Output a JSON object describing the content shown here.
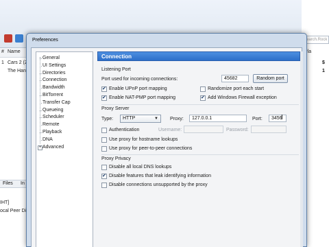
{
  "background_app": {
    "columns": [
      "#",
      "Name"
    ],
    "rows": [
      {
        "num": "1",
        "name": "Cars 2 (2("
      },
      {
        "num": "",
        "name": "The Hang"
      }
    ],
    "tabs": [
      "Files",
      "In"
    ],
    "bottom_lines": [
      "IHT]",
      "ocal Peer Di"
    ],
    "right_panel": {
      "search_text": "earch.Rock",
      "header": "Pla",
      "values": [
        "$",
        "1"
      ]
    }
  },
  "dialog": {
    "title": "Preferences",
    "tree": {
      "items": [
        {
          "label": "General",
          "selected": false
        },
        {
          "label": "UI Settings",
          "selected": false
        },
        {
          "label": "Directories",
          "selected": false
        },
        {
          "label": "Connection",
          "selected": true
        },
        {
          "label": "Bandwidth",
          "selected": false
        },
        {
          "label": "BitTorrent",
          "selected": false
        },
        {
          "label": "Transfer Cap",
          "selected": false
        },
        {
          "label": "Queueing",
          "selected": false
        },
        {
          "label": "Scheduler",
          "selected": false
        },
        {
          "label": "Remote",
          "selected": false
        },
        {
          "label": "Playback",
          "selected": false
        },
        {
          "label": "DNA",
          "selected": false
        },
        {
          "label": "Advanced",
          "selected": false,
          "expandable": true
        }
      ],
      "expander_symbol": "+"
    },
    "panel": {
      "title": "Connection",
      "listening_port": {
        "title": "Listening Port",
        "port_label": "Port used for incoming connections:",
        "port_value": "45682",
        "random_button": "Random port",
        "upnp": {
          "label": "Enable UPnP port mapping",
          "checked": true
        },
        "natpmp": {
          "label": "Enable NAT-PMP port mapping",
          "checked": true
        },
        "randomize": {
          "label": "Randomize port each start",
          "checked": false
        },
        "firewall": {
          "label": "Add Windows Firewall exception",
          "checked": true
        }
      },
      "proxy_server": {
        "title": "Proxy Server",
        "type_label": "Type:",
        "type_value": "HTTP",
        "proxy_label": "Proxy:",
        "proxy_value": "127.0.0.1",
        "port_label": "Port:",
        "port_value": "3456",
        "authentication": {
          "label": "Authentication",
          "checked": false
        },
        "username_label": "Username:",
        "password_label": "Password:",
        "hostname_lookups": {
          "label": "Use proxy for hostname lookups",
          "checked": false
        },
        "peer_connections": {
          "label": "Use proxy for peer-to-peer connections",
          "checked": false
        }
      },
      "proxy_privacy": {
        "title": "Proxy Privacy",
        "disable_dns": {
          "label": "Disable all local DNS lookups",
          "checked": false
        },
        "disable_leak": {
          "label": "Disable features that leak identifying information",
          "checked": true
        },
        "disable_unsupported": {
          "label": "Disable connections unsupported by the proxy",
          "checked": false
        }
      }
    }
  },
  "colors": {
    "panel_header": "#2d6fca",
    "dialog_frame": "#cfdcec"
  }
}
